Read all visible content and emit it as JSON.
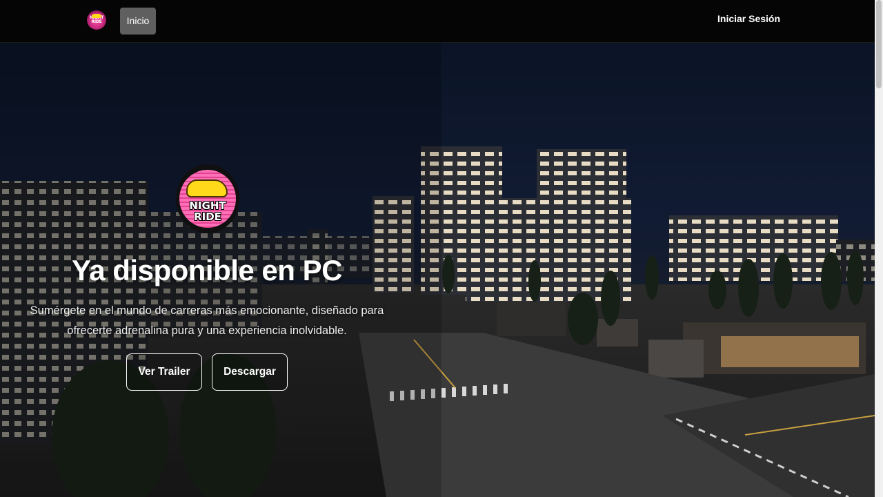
{
  "nav": {
    "logo_text": "NIGHT RIDE",
    "home_label": "Inicio",
    "login_label": "Iniciar Sesión"
  },
  "hero": {
    "logo_text_line1": "NIGHT",
    "logo_text_line2": "RIDE",
    "title": "Ya disponible en PC",
    "subtitle": "Sumérgete en el mundo de carreras más emocionante, diseñado para ofrecerte adrenalina pura y una experiencia inolvidable.",
    "buttons": {
      "trailer_label": "Ver Trailer",
      "download_label": "Descargar"
    }
  },
  "colors": {
    "navbar_bg": "#050505",
    "active_nav_bg": "#5f5f5f",
    "logo_pink": "#ff4fa8",
    "logo_car": "#ffd91a"
  }
}
